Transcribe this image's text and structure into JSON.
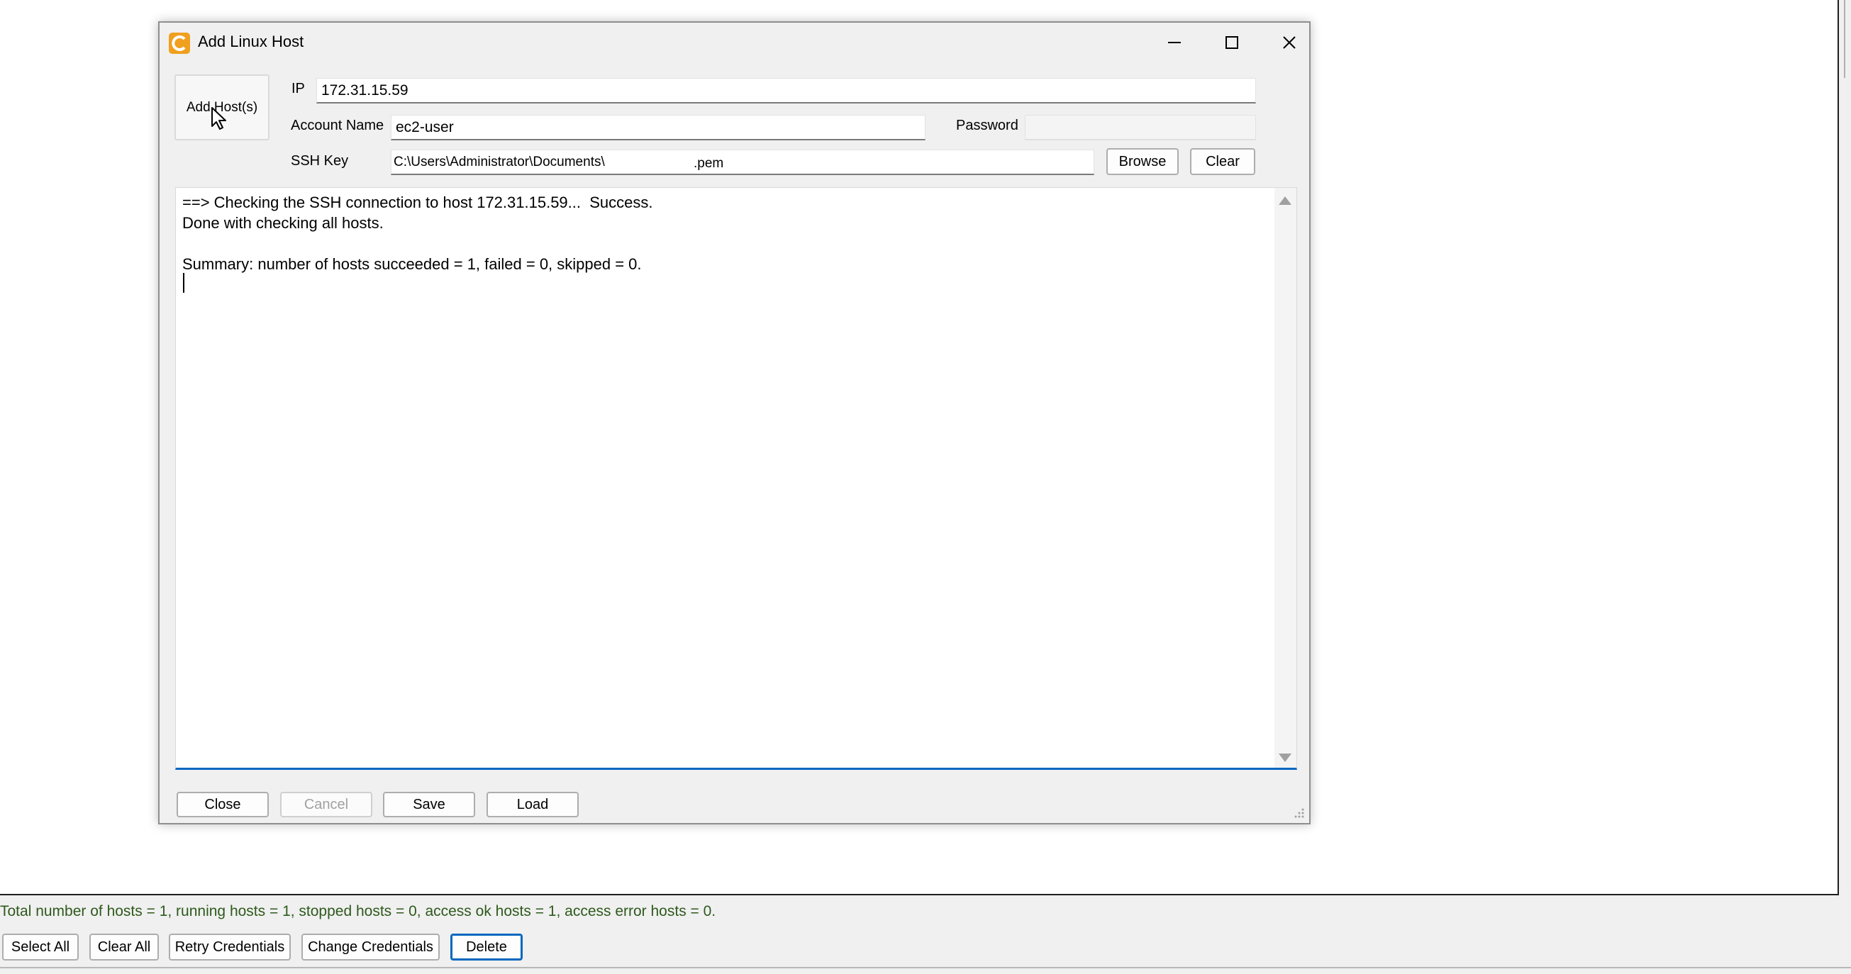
{
  "dialog": {
    "title": "Add Linux Host",
    "add_hosts_label": "Add Host(s)",
    "ip_label": "IP",
    "ip_value": "172.31.15.59",
    "account_label": "Account Name",
    "account_value": "ec2-user",
    "password_label": "Password",
    "password_value": "",
    "ssh_label": "SSH Key",
    "ssh_value": "C:\\Users\\Administrator\\Documents\\",
    "ssh_suffix": ".pem",
    "browse_label": "Browse",
    "clear_label": "Clear",
    "log_lines": [
      "==> Checking the SSH connection to host 172.31.15.59...  Success.",
      "Done with checking all hosts.",
      "",
      "Summary: number of hosts succeeded = 1, failed = 0, skipped = 0."
    ],
    "footer": {
      "close": "Close",
      "cancel": "Cancel",
      "save": "Save",
      "load": "Load"
    }
  },
  "status": {
    "text": "Total number of hosts = 1, running hosts = 1, stopped hosts = 0, access ok hosts = 1, access error hosts = 0."
  },
  "bottom_buttons": {
    "select_all": "Select All",
    "clear_all": "Clear All",
    "retry_credentials": "Retry Credentials",
    "change_credentials": "Change Credentials",
    "delete": "Delete"
  },
  "icons": {
    "app": "app-logo-icon",
    "minimize": "minimize-icon",
    "maximize": "maximize-icon",
    "close": "close-icon"
  },
  "colors": {
    "accent": "#0067c0",
    "status_text": "#2e5a1c",
    "app_icon": "#f0a01e"
  }
}
